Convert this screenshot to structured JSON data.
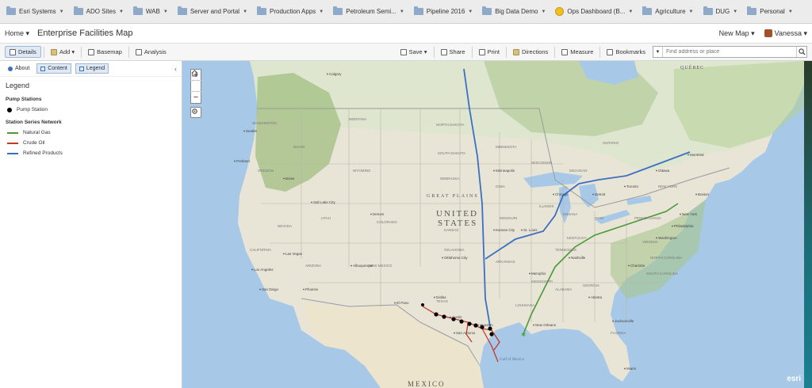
{
  "bookmarks": [
    {
      "label": "Esri Systems"
    },
    {
      "label": "ADO Sites"
    },
    {
      "label": "WAB"
    },
    {
      "label": "Server and Portal"
    },
    {
      "label": "Production Apps"
    },
    {
      "label": "Petroleum Semi..."
    },
    {
      "label": "Pipeline 2016"
    },
    {
      "label": "Big Data Demo"
    },
    {
      "label": "Ops Dashboard (B..."
    },
    {
      "label": "Agriculture"
    },
    {
      "label": "DUG"
    },
    {
      "label": "Personal"
    }
  ],
  "app": {
    "home": "Home ▾",
    "title": "Enterprise Facilities Map",
    "new_map": "New Map ▾",
    "user": "Vanessa ▾"
  },
  "toolbar": {
    "details": "Details",
    "add": "Add ▾",
    "basemap": "Basemap",
    "analysis": "Analysis",
    "save": "Save ▾",
    "share": "Share",
    "print": "Print",
    "directions": "Directions",
    "measure": "Measure",
    "bookmarks": "Bookmarks",
    "search_placeholder": "Find address or place"
  },
  "panel": {
    "tabs": {
      "about": "About",
      "content": "Content",
      "legend": "Legend"
    },
    "legend_title": "Legend",
    "sections": [
      {
        "title": "Pump Stations",
        "items": [
          {
            "label": "Pump Station",
            "color": "#000000",
            "kind": "point"
          }
        ]
      },
      {
        "title": "Station Series Network",
        "items": [
          {
            "label": "Natural Gas",
            "color": "#4a9a3a",
            "kind": "line"
          },
          {
            "label": "Crude Oil",
            "color": "#c0392b",
            "kind": "line"
          },
          {
            "label": "Refined Products",
            "color": "#3a6fc4",
            "kind": "line"
          }
        ]
      }
    ]
  },
  "map": {
    "labels": {
      "usa1": "UNITED",
      "usa2": "STATES",
      "mexico": "MEXICO",
      "great_plains": "GREAT PLAINS",
      "quebec": "QUÉBEC",
      "gulf": "Gulf of Mexico"
    },
    "states": [
      "WASHINGTON",
      "OREGON",
      "IDAHO",
      "MONTANA",
      "WYOMING",
      "NEVADA",
      "UTAH",
      "COLORADO",
      "CALIFORNIA",
      "ARIZONA",
      "NEW MEXICO",
      "NORTH DAKOTA",
      "SOUTH DAKOTA",
      "NEBRASKA",
      "KANSAS",
      "OKLAHOMA",
      "TEXAS",
      "MINNESOTA",
      "IOWA",
      "MISSOURI",
      "ARKANSAS",
      "LOUISIANA",
      "MISSISSIPPI",
      "ALABAMA",
      "GEORGIA",
      "FLORIDA",
      "ILLINOIS",
      "INDIANA",
      "OHIO",
      "KENTUCKY",
      "TENNESSEE",
      "MICHIGAN",
      "WISCONSIN",
      "PENNSYLVANIA",
      "NEW YORK",
      "VIRGINIA",
      "NORTH CAROLINA",
      "SOUTH CAROLINA",
      "ONTARIO"
    ],
    "cities": [
      "Calgary",
      "Seattle",
      "Portland",
      "Boise",
      "Salt Lake City",
      "Denver",
      "Las Vegas",
      "Los Angeles",
      "San Diego",
      "Phoenix",
      "Albuquerque",
      "El Paso",
      "Dallas",
      "Houston",
      "San Antonio",
      "Austin",
      "Oklahoma City",
      "Kansas City",
      "Chicago",
      "Detroit",
      "Toronto",
      "Ottawa",
      "Montréal",
      "New York",
      "Philadelphia",
      "Washington",
      "Atlanta",
      "Nashville",
      "Memphis",
      "New Orleans",
      "Jacksonville",
      "Miami",
      "St. Louis",
      "Minneapolis",
      "Charlotte",
      "Boston"
    ],
    "brand": "esri"
  }
}
